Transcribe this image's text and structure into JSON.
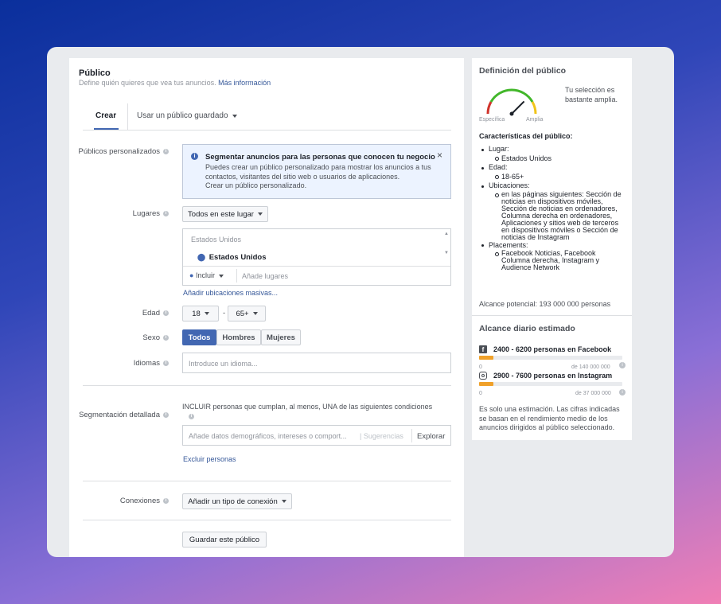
{
  "audience": {
    "title": "Público",
    "subtitle": "Define quién quieres que vea tus anuncios.",
    "more_info_link": "Más información",
    "tabs": [
      {
        "label": "Crear",
        "active": true
      },
      {
        "label": "Usar un público guardado",
        "active": false
      }
    ],
    "custom_audiences": {
      "label": "Públicos personalizados",
      "notice_title": "Segmentar anuncios para las personas que conocen tu negocio",
      "notice_body": "Puedes crear un público personalizado para mostrar los anuncios a tus contactos, visitantes del sitio web o usuarios de aplicaciones.",
      "notice_link": "Crear un público personalizado."
    },
    "locations": {
      "label": "Lugares",
      "dropdown_value": "Todos en este lugar",
      "list_header": "Estados Unidos",
      "selected_item": "Estados Unidos",
      "include_label": "Incluir",
      "add_placeholder": "Añade lugares",
      "bulk_link": "Añadir ubicaciones masivas..."
    },
    "age": {
      "label": "Edad",
      "min": "18",
      "separator": "-",
      "max": "65+"
    },
    "gender": {
      "label": "Sexo",
      "options": [
        "Todos",
        "Hombres",
        "Mujeres"
      ]
    },
    "languages": {
      "label": "Idiomas",
      "placeholder": "Introduce un idioma..."
    },
    "detailed_targeting": {
      "label": "Segmentación detallada",
      "include_text": "INCLUIR personas que cumplan, al menos, UNA de las siguientes condiciones",
      "input_placeholder": "Añade datos demográficos, intereses o comport...",
      "suggestions": "Sugerencias",
      "browse": "Explorar",
      "exclude_link": "Excluir personas"
    },
    "connections": {
      "label": "Conexiones",
      "dropdown_value": "Añadir un tipo de conexión"
    },
    "save_button": "Guardar este público"
  },
  "definition": {
    "title": "Definición del público",
    "gauge_left": "Específica",
    "gauge_right": "Amplia",
    "gauge_level": 0.75,
    "gauge_text": "Tu selección es bastante amplia.",
    "characteristics_title": "Características del público:",
    "items": [
      {
        "label": "Lugar:",
        "children": [
          "Estados Unidos"
        ]
      },
      {
        "label": "Edad:",
        "children": [
          "18-65+"
        ]
      },
      {
        "label": "Ubicaciones:",
        "children": [
          "en las páginas siguientes: Sección de noticias en dispositivos móviles, Sección de noticias en ordenadores, Columna derecha en ordenadores, Aplicaciones y sitios web de terceros en dispositivos móviles o Sección de noticias de Instagram"
        ]
      },
      {
        "label": "Placements:",
        "children": [
          "Facebook Noticias, Facebook Columna derecha, Instagram y Audience Network"
        ]
      }
    ],
    "potential_reach": "Alcance potencial: 193 000 000 personas"
  },
  "daily_reach": {
    "title": "Alcance diario estimado",
    "facebook": {
      "text": "2400 - 6200 personas en Facebook",
      "min_label": "0",
      "max_label": "de 140 000 000",
      "fill": 0.1
    },
    "instagram": {
      "text": "2900 - 7600 personas en Instagram",
      "min_label": "0",
      "max_label": "de 37 000 000",
      "fill": 0.1
    },
    "note": "Es solo una estimación. Las cifras indicadas se basan en el rendimiento medio de los anuncios dirigidos al público seleccionado."
  },
  "colors": {
    "accent": "#4267b2",
    "link": "#365899",
    "reach_bar": "#f0a12a",
    "gauge_red": "#d0342c",
    "gauge_green": "#42b72a",
    "gauge_yellow": "#f0c419"
  }
}
